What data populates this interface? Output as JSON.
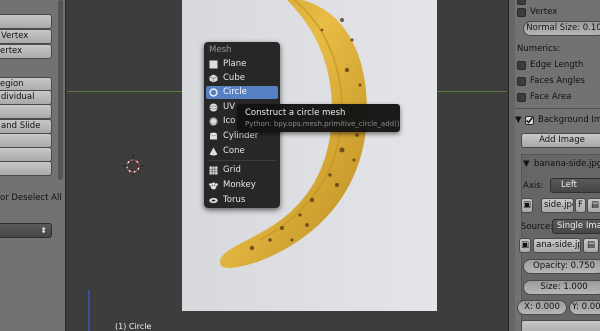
{
  "left_panel": {
    "buttons": [
      "",
      "Vertex",
      "",
      "Region",
      "Individual",
      "",
      "and Slide",
      "",
      "",
      ""
    ],
    "deselect_text": "or Deselect All",
    "dropdown_arrow": "⬍"
  },
  "menu": {
    "title": "Mesh",
    "items": [
      {
        "label": "Plane",
        "icon": "plane-icon"
      },
      {
        "label": "Cube",
        "icon": "cube-icon"
      },
      {
        "label": "Circle",
        "icon": "circle-icon",
        "active": true
      },
      {
        "label": "UV Sphere",
        "display": "UV",
        "icon": "uv-sphere-icon"
      },
      {
        "label": "Icosphere",
        "display": "Ico",
        "icon": "icosphere-icon"
      },
      {
        "label": "Cylinder",
        "icon": "cylinder-icon"
      },
      {
        "label": "Cone",
        "icon": "cone-icon"
      },
      {
        "label": "Grid",
        "icon": "grid-icon"
      },
      {
        "label": "Monkey",
        "icon": "monkey-icon"
      },
      {
        "label": "Torus",
        "icon": "torus-icon"
      }
    ]
  },
  "tooltip": {
    "title": "Construct a circle mesh",
    "python": "Python: bpy.ops.mesh.primitive_circle_add()"
  },
  "right_panel": {
    "vertex_label": "Vertex",
    "normal_size": "Normal Size: 0.10",
    "numerics_label": "Numerics:",
    "edge_length": "Edge Length",
    "faces_angles": "Faces Angles",
    "face_area": "Face Area",
    "background_images": "Background Ima",
    "add_image": "Add Image",
    "image_name": "banana-side.jpg",
    "axis_label": "Axis:",
    "axis_value": "Left",
    "file_name": "side.jpg",
    "f_label": "F",
    "source_label": "Source:",
    "source_value": "Single Imag",
    "image_file": "ana-side.jpg",
    "opacity": "Opacity: 0.750",
    "size": "Size: 1.000",
    "x_offset": "X: 0.000",
    "y_offset": "Y: 0.000"
  },
  "viewport": {
    "view_label": "(1) Circle"
  },
  "colors": {
    "menu_highlight": "#5680c2",
    "banana": "#e6b93a",
    "x_axis": "#5a7a3a",
    "y_axis": "#3a4fa0"
  }
}
